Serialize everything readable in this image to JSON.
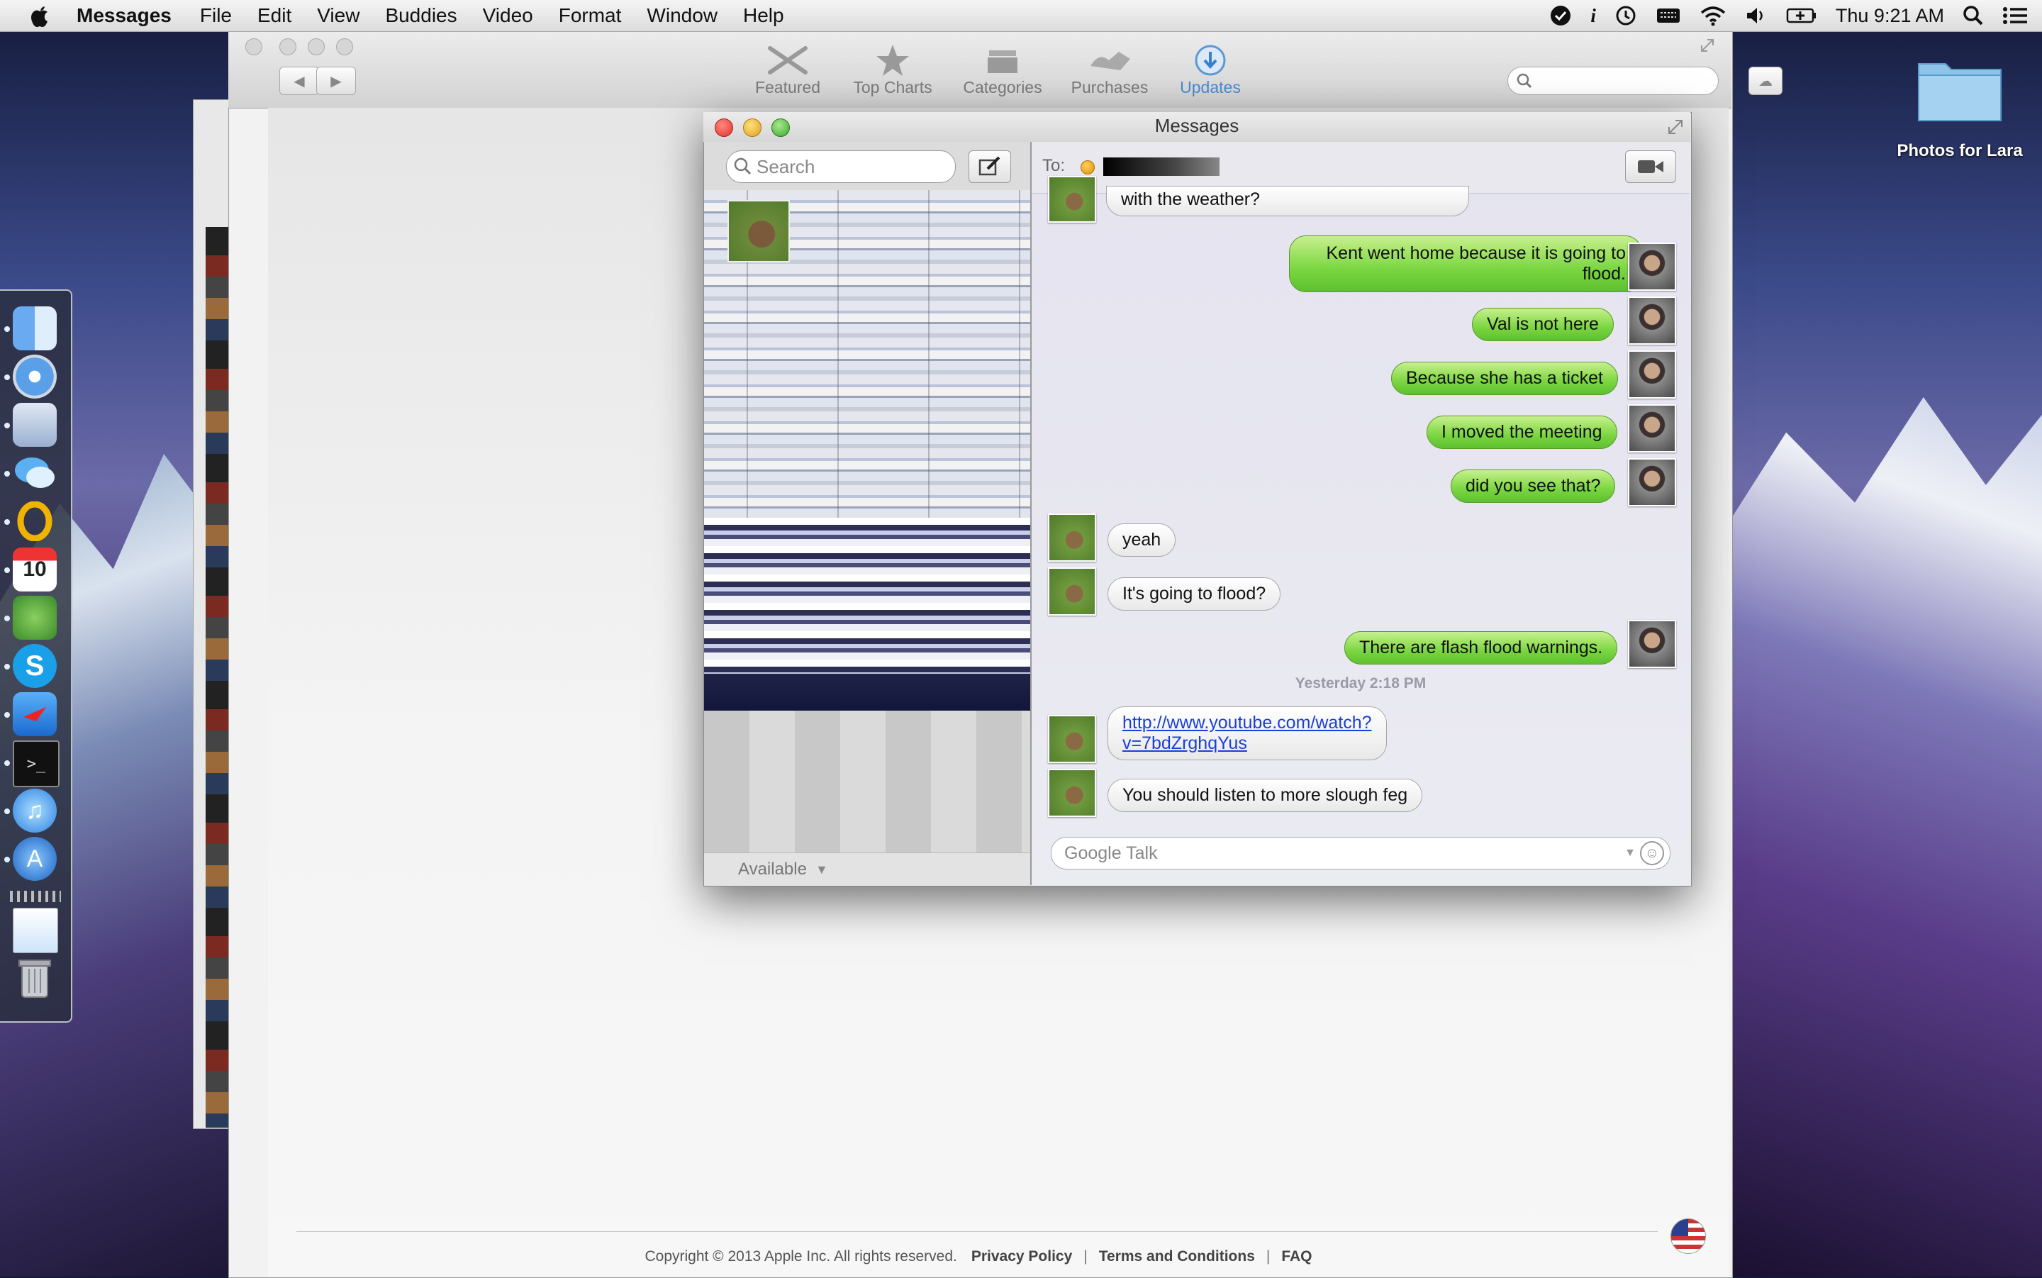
{
  "menubar": {
    "app": "Messages",
    "items": [
      "File",
      "Edit",
      "View",
      "Buddies",
      "Video",
      "Format",
      "Window",
      "Help"
    ],
    "clock": "Thu 9:21 AM"
  },
  "appstore": {
    "toolbar": [
      "Featured",
      "Top Charts",
      "Categories",
      "Purchases",
      "Updates"
    ],
    "footer": {
      "copyright": "Copyright © 2013 Apple Inc. All rights reserved.",
      "privacy": "Privacy Policy",
      "terms": "Terms and Conditions",
      "faq": "FAQ",
      "sep": "|"
    }
  },
  "desktop": {
    "folder_label": "Photos for Lara"
  },
  "messages": {
    "title": "Messages",
    "search_placeholder": "Search",
    "status": "Available",
    "to_label": "To:",
    "truncated_first": "with the weather?",
    "conversation": [
      {
        "from": "me",
        "text": "Kent went home because it is going to",
        "text2": "flood."
      },
      {
        "from": "me",
        "text": "Val is not here"
      },
      {
        "from": "me",
        "text": "Because she has a ticket"
      },
      {
        "from": "me",
        "text": "I moved the meeting"
      },
      {
        "from": "me",
        "text": "did you see that?"
      },
      {
        "from": "them",
        "text": "yeah"
      },
      {
        "from": "them",
        "text": "It's going to flood?"
      },
      {
        "from": "me",
        "text": "There are flash flood warnings."
      },
      {
        "from": "them",
        "text": "http://www.youtube.com/watch?",
        "text2": "v=7bdZrghqYus"
      },
      {
        "from": "them",
        "text": "You should listen to more slough feg"
      }
    ],
    "timestamp": "Yesterday 2:18 PM",
    "input_placeholder": "Google Talk"
  },
  "colors": {
    "me_bubble": "#7ad640",
    "them_bubble": "#ffffff",
    "link": "#1a3fd8"
  }
}
